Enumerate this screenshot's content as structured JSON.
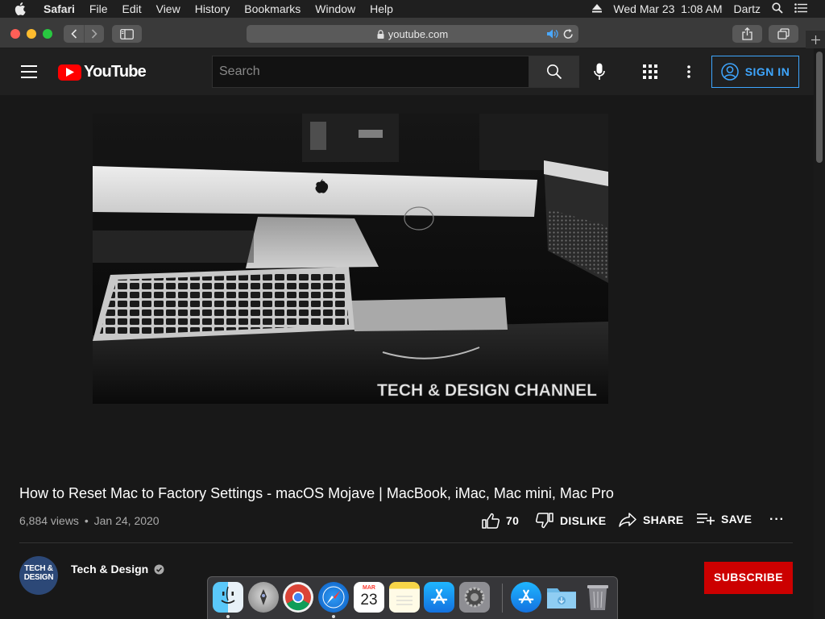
{
  "menubar": {
    "app_name": "Safari",
    "menus": [
      "File",
      "Edit",
      "View",
      "History",
      "Bookmarks",
      "Window",
      "Help"
    ],
    "datetime": "Wed Mar 23  1:08 AM",
    "user": "Dartz"
  },
  "browser": {
    "url": "youtube.com"
  },
  "youtube": {
    "logo_text": "YouTube",
    "search_placeholder": "Search",
    "signin_label": "SIGN IN",
    "video_overlay_text": "TECH & DESIGN CHANNEL",
    "video_title": "How to Reset Mac to Factory Settings - macOS Mojave | MacBook, iMac, Mac mini, Mac Pro",
    "views": "6,884 views",
    "separator": "•",
    "date": "Jan 24, 2020",
    "like_count": "70",
    "dislike_label": "DISLIKE",
    "share_label": "SHARE",
    "save_label": "SAVE",
    "more_label": "···",
    "channel_name": "Tech & Design",
    "avatar_text": "TECH & DESIGN",
    "subscribe_label": "SUBSCRIBE"
  },
  "dock": {
    "calendar_month": "MAR",
    "calendar_day": "23",
    "apps": [
      "finder-icon",
      "launchpad-icon",
      "chrome-icon",
      "safari-icon",
      "calendar-icon",
      "notes-icon",
      "app-store-icon",
      "system-preferences-icon",
      "app-store-folder-icon",
      "downloads-folder-icon",
      "trash-icon"
    ]
  },
  "colors": {
    "youtube_red": "#ff0000",
    "signin_blue": "#3ea6ff",
    "subscribe_red": "#cc0000",
    "page_bg": "#181818"
  }
}
